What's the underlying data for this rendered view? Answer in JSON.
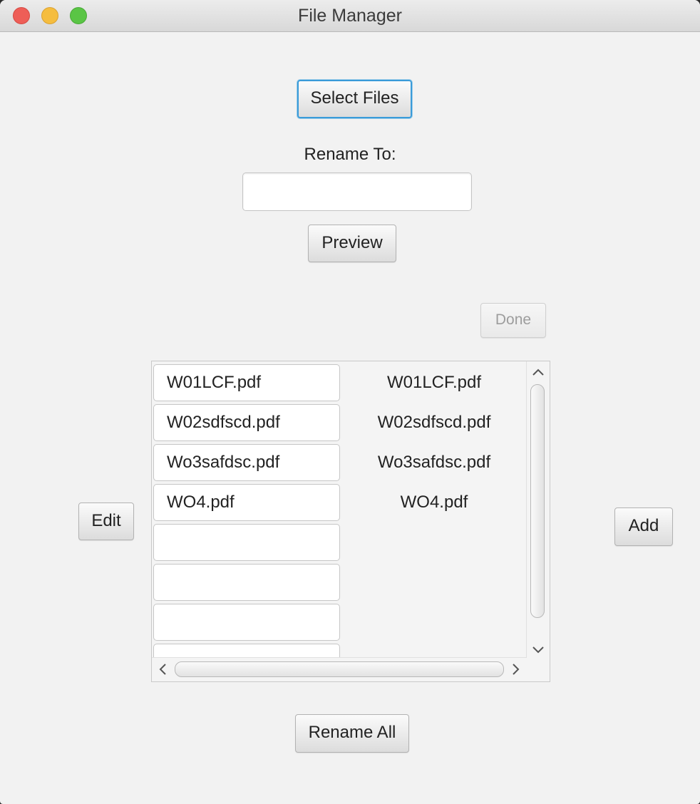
{
  "window": {
    "title": "File Manager"
  },
  "buttons": {
    "select_files": "Select Files",
    "preview": "Preview",
    "done": "Done",
    "edit": "Edit",
    "add": "Add",
    "rename_all": "Rename All"
  },
  "rename": {
    "label": "Rename To:",
    "value": ""
  },
  "files": {
    "rows": [
      {
        "name": "W01LCF.pdf",
        "preview": "W01LCF.pdf"
      },
      {
        "name": "W02sdfscd.pdf",
        "preview": "W02sdfscd.pdf"
      },
      {
        "name": "Wo3safdsc.pdf",
        "preview": "Wo3safdsc.pdf"
      },
      {
        "name": "WO4.pdf",
        "preview": "WO4.pdf"
      },
      {
        "name": "",
        "preview": ""
      },
      {
        "name": "",
        "preview": ""
      },
      {
        "name": "",
        "preview": ""
      },
      {
        "name": "",
        "preview": ""
      }
    ]
  },
  "icons": {
    "scroll_up": "chevron-up-icon",
    "scroll_down": "chevron-down-icon",
    "scroll_left": "chevron-left-icon",
    "scroll_right": "chevron-right-icon"
  },
  "colors": {
    "focus_ring": "#3a9bd9",
    "close": "#ee5e57",
    "minimize": "#f5bd3f",
    "zoom": "#5ac545"
  }
}
